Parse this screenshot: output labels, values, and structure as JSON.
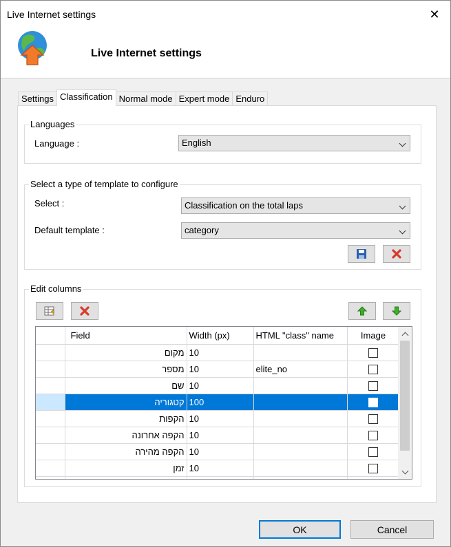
{
  "window": {
    "title": "Live Internet settings",
    "close_glyph": "✕"
  },
  "header": {
    "title": "Live Internet settings",
    "icon": "globe-upload-icon"
  },
  "tabs": [
    {
      "label": "Settings",
      "active": false
    },
    {
      "label": "Classification",
      "active": true
    },
    {
      "label": "Normal mode",
      "active": false
    },
    {
      "label": "Expert mode",
      "active": false
    },
    {
      "label": "Enduro",
      "active": false
    }
  ],
  "languages": {
    "group_label": "Languages",
    "language_label": "Language :",
    "language_value": "English"
  },
  "template": {
    "group_label": "Select a type of template to configure",
    "select_label": "Select :",
    "select_value": "Classification on the total laps",
    "default_label": "Default template :",
    "default_value": "category",
    "save_icon": "save-icon",
    "delete_icon": "delete-icon"
  },
  "columns": {
    "group_label": "Edit columns",
    "add_icon": "add-column-icon",
    "remove_icon": "remove-column-icon",
    "move_up_icon": "arrow-up-icon",
    "move_down_icon": "arrow-down-icon",
    "headers": {
      "field": "Field",
      "width": "Width (px)",
      "class": "HTML \"class\" name",
      "image": "Image"
    },
    "rows": [
      {
        "field": "מקום",
        "width": "10",
        "class": "",
        "image": false,
        "selected": false
      },
      {
        "field": "מספר",
        "width": "10",
        "class": "elite_no",
        "image": false,
        "selected": false
      },
      {
        "field": "שם",
        "width": "10",
        "class": "",
        "image": false,
        "selected": false
      },
      {
        "field": "קטגוריה",
        "width": "100",
        "class": "",
        "image": false,
        "selected": true
      },
      {
        "field": "הקפות",
        "width": "10",
        "class": "",
        "image": false,
        "selected": false
      },
      {
        "field": "הקפה אחרונה",
        "width": "10",
        "class": "",
        "image": false,
        "selected": false
      },
      {
        "field": "הקפה מהירה",
        "width": "10",
        "class": "",
        "image": false,
        "selected": false
      },
      {
        "field": "זמן",
        "width": "10",
        "class": "",
        "image": false,
        "selected": false
      }
    ]
  },
  "footer": {
    "ok_label": "OK",
    "cancel_label": "Cancel"
  }
}
